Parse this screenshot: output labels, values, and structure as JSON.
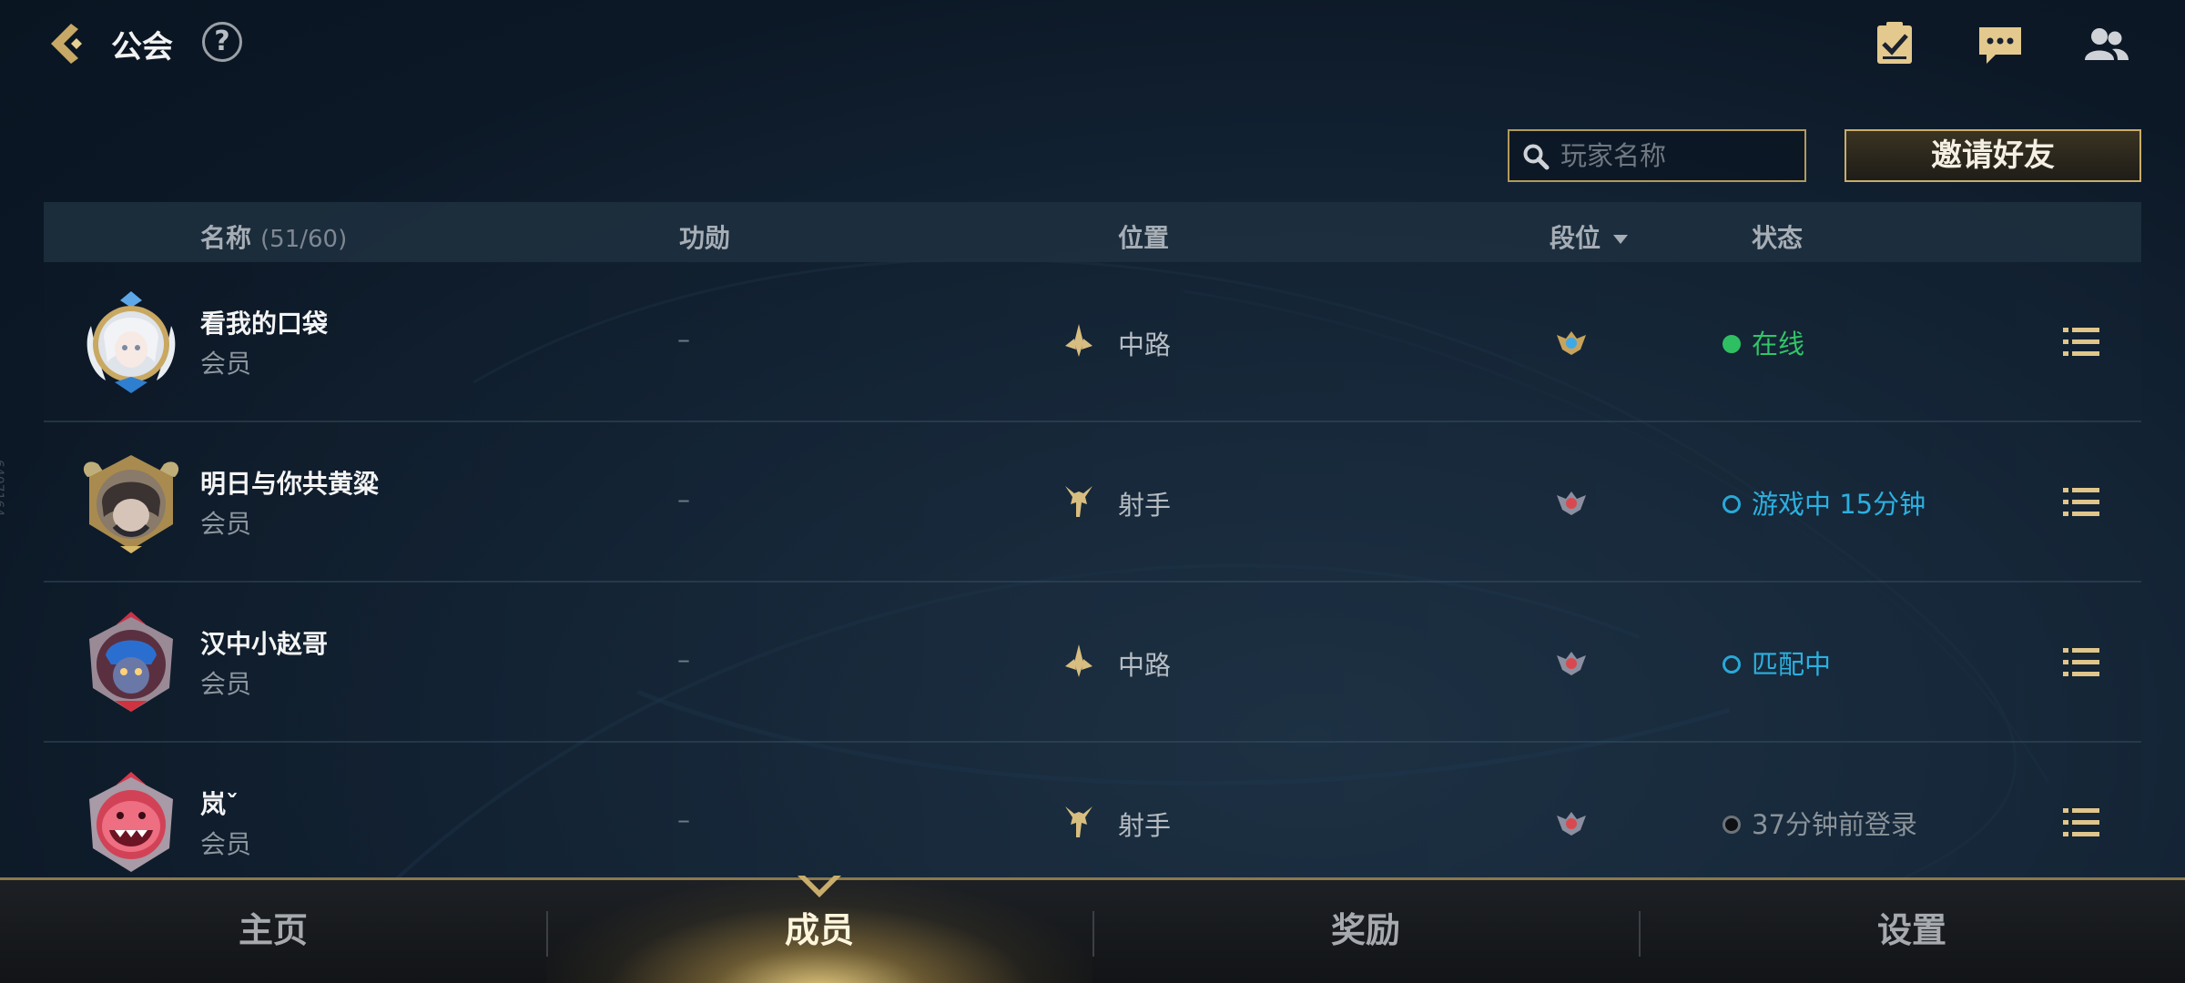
{
  "header": {
    "title": "公会",
    "help_label": "?"
  },
  "toolbar": {
    "search_placeholder": "玩家名称",
    "invite_label": "邀请好友"
  },
  "table": {
    "columns": {
      "name": "名称",
      "count": "(51/60)",
      "merit": "功勋",
      "position": "位置",
      "rank": "段位",
      "status": "状态"
    },
    "rows": [
      {
        "name": "看我的口袋",
        "role": "会员",
        "merit": "–",
        "position": "中路",
        "status": "在线",
        "status_type": "online"
      },
      {
        "name": "明日与你共黄粱",
        "role": "会员",
        "merit": "–",
        "position": "射手",
        "status": "游戏中 15分钟",
        "status_type": "in-game"
      },
      {
        "name": "汉中小赵哥",
        "role": "会员",
        "merit": "–",
        "position": "中路",
        "status": "匹配中",
        "status_type": "matching"
      },
      {
        "name": "岚ˇ",
        "role": "会员",
        "merit": "–",
        "position": "射手",
        "status": "37分钟前登录",
        "status_type": "offline"
      }
    ]
  },
  "bottom_nav": {
    "tabs": [
      "主页",
      "成员",
      "奖励",
      "设置"
    ],
    "active": "成员"
  },
  "edge_text": "6407164",
  "colors": {
    "accent_gold": "#c9ad6a",
    "online_green": "#32c467",
    "ingame_blue": "#2bb0e0",
    "offline_gray": "#8a9299"
  }
}
